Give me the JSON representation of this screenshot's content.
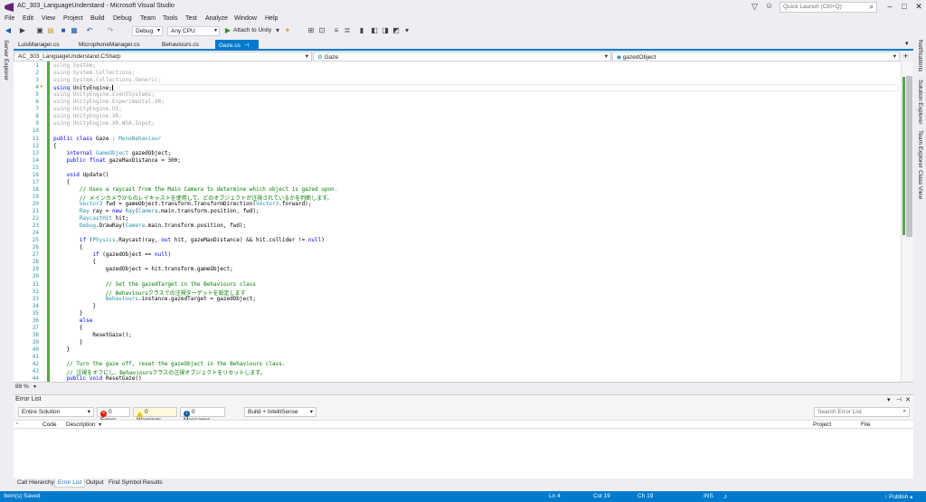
{
  "window": {
    "title": "AC_303_LanguageUnderstand - Microsoft Visual Studio",
    "quick_launch_placeholder": "Quick Launch (Ctrl+Q)",
    "controls": [
      "–",
      "□",
      "✕"
    ]
  },
  "menu": [
    "File",
    "Edit",
    "View",
    "Project",
    "Build",
    "Debug",
    "Team",
    "Tools",
    "Test",
    "Analyze",
    "Window",
    "Help"
  ],
  "toolbar": {
    "config": "Debug",
    "platform": "Any CPU",
    "run_label": "Attach to Unity"
  },
  "tabs": [
    {
      "label": "LuisManager.cs",
      "active": false
    },
    {
      "label": "MicrophoneManager.cs",
      "active": false
    },
    {
      "label": "Behaviours.cs",
      "active": false
    },
    {
      "label": "Gaze.cs",
      "active": true
    }
  ],
  "left_panel": {
    "label": "Server Explorer"
  },
  "right_panel": {
    "labels": [
      "Notifications",
      "Solution Explorer",
      "Team Explorer",
      "Class View"
    ]
  },
  "navigation": {
    "project": "AC_303_LanguageUnderstand.CSharp",
    "type": "Gaze",
    "member": "gazedObject"
  },
  "code": {
    "lines": [
      {
        "n": "1",
        "text": "using System;",
        "cls": "cgray"
      },
      {
        "n": "2",
        "text": "using System.Collections;",
        "cls": "cgray"
      },
      {
        "n": "3",
        "text": "using System.Collections.Generic;",
        "cls": "cgray"
      },
      {
        "n": "4",
        "text": "using UnityEngine;",
        "cls": ""
      },
      {
        "n": "5",
        "text": "using UnityEngine.EventSystems;",
        "cls": "cgray"
      },
      {
        "n": "6",
        "text": "using UnityEngine.Experimental.XR;",
        "cls": "cgray"
      },
      {
        "n": "7",
        "text": "using UnityEngine.UI;",
        "cls": "cgray"
      },
      {
        "n": "8",
        "text": "using UnityEngine.XR;",
        "cls": "cgray"
      },
      {
        "n": "9",
        "text": "using UnityEngine.XR.WSA.Input;",
        "cls": "cgray"
      },
      {
        "n": "10",
        "text": "",
        "cls": ""
      },
      {
        "n": "11",
        "text": "public class Gaze : MonoBehaviour",
        "cls": ""
      },
      {
        "n": "12",
        "text": "{",
        "cls": ""
      },
      {
        "n": "13",
        "text": "    internal GameObject gazedObject;",
        "cls": ""
      },
      {
        "n": "14",
        "text": "    public float gazeMaxDistance = 300;",
        "cls": ""
      },
      {
        "n": "15",
        "text": "",
        "cls": ""
      },
      {
        "n": "16",
        "text": "    void Update()",
        "cls": ""
      },
      {
        "n": "17",
        "text": "    {",
        "cls": ""
      },
      {
        "n": "18",
        "text": "        // Uses a raycast from the Main Camera to determine which object is gazed upon.",
        "cls": "cgreen"
      },
      {
        "n": "19",
        "text": "        // メインカメラからのレイキャストを使用して、どのオブジェクトが注視されているかを判断します。",
        "cls": "cgreen"
      },
      {
        "n": "20",
        "text": "        Vector3 fwd = gameObject.transform.TransformDirection(Vector3.forward);",
        "cls": ""
      },
      {
        "n": "21",
        "text": "        Ray ray = new Ray(Camera.main.transform.position, fwd);",
        "cls": ""
      },
      {
        "n": "22",
        "text": "        RaycastHit hit;",
        "cls": ""
      },
      {
        "n": "23",
        "text": "        Debug.DrawRay(Camera.main.transform.position, fwd);",
        "cls": ""
      },
      {
        "n": "24",
        "text": "",
        "cls": ""
      },
      {
        "n": "25",
        "text": "        if (Physics.Raycast(ray, out hit, gazeMaxDistance) && hit.collider != null)",
        "cls": ""
      },
      {
        "n": "26",
        "text": "        {",
        "cls": ""
      },
      {
        "n": "27",
        "text": "            if (gazedObject == null)",
        "cls": ""
      },
      {
        "n": "28",
        "text": "            {",
        "cls": ""
      },
      {
        "n": "29",
        "text": "                gazedObject = hit.transform.gameObject;",
        "cls": ""
      },
      {
        "n": "30",
        "text": "",
        "cls": ""
      },
      {
        "n": "31",
        "text": "                // Set the gazedTarget in the Behaviours class",
        "cls": "cgreen"
      },
      {
        "n": "32",
        "text": "                // Behavioursクラスでの注視ターゲットを設定します",
        "cls": "cgreen"
      },
      {
        "n": "33",
        "text": "                Behaviours.instance.gazedTarget = gazedObject;",
        "cls": ""
      },
      {
        "n": "34",
        "text": "            }",
        "cls": ""
      },
      {
        "n": "35",
        "text": "        }",
        "cls": ""
      },
      {
        "n": "36",
        "text": "        else",
        "cls": ""
      },
      {
        "n": "37",
        "text": "        {",
        "cls": ""
      },
      {
        "n": "38",
        "text": "            ResetGaze();",
        "cls": ""
      },
      {
        "n": "39",
        "text": "        }",
        "cls": ""
      },
      {
        "n": "40",
        "text": "    }",
        "cls": ""
      },
      {
        "n": "41",
        "text": "",
        "cls": ""
      },
      {
        "n": "42",
        "text": "    // Turn the gaze off, reset the gazeObject in the Behaviours class.",
        "cls": "cgreen"
      },
      {
        "n": "43",
        "text": "    // 注視をオフにし、Behavioursクラスの注視オブジェクトをリセットします。",
        "cls": "cgreen"
      },
      {
        "n": "44",
        "text": "    public void ResetGaze()",
        "cls": ""
      }
    ]
  },
  "zoom": "89 %",
  "error_list": {
    "title": "Error List",
    "scope": "Entire Solution",
    "errors": "0 Errors",
    "warnings": "0 Warnings",
    "messages": "0 Messages",
    "build_filter": "Build + IntelliSense",
    "search_placeholder": "Search Error List",
    "columns": [
      "Code",
      "Description",
      "Project",
      "File"
    ]
  },
  "bottom_tabs": [
    {
      "label": "Call Hierarchy",
      "active": false
    },
    {
      "label": "Error List",
      "active": true
    },
    {
      "label": "Output",
      "active": false
    },
    {
      "label": "Find Symbol Results",
      "active": false
    }
  ],
  "status": {
    "message": "Item(s) Saved",
    "ln": "Ln 4",
    "col": "Col 19",
    "ch": "Ch 19",
    "mode": "INS",
    "publish": "↑ Publish ▴"
  },
  "colors": {
    "accent": "#007acc",
    "chrome": "#eeeef2",
    "comment": "#008000",
    "keyword": "#0000ff",
    "type": "#2b91af"
  }
}
